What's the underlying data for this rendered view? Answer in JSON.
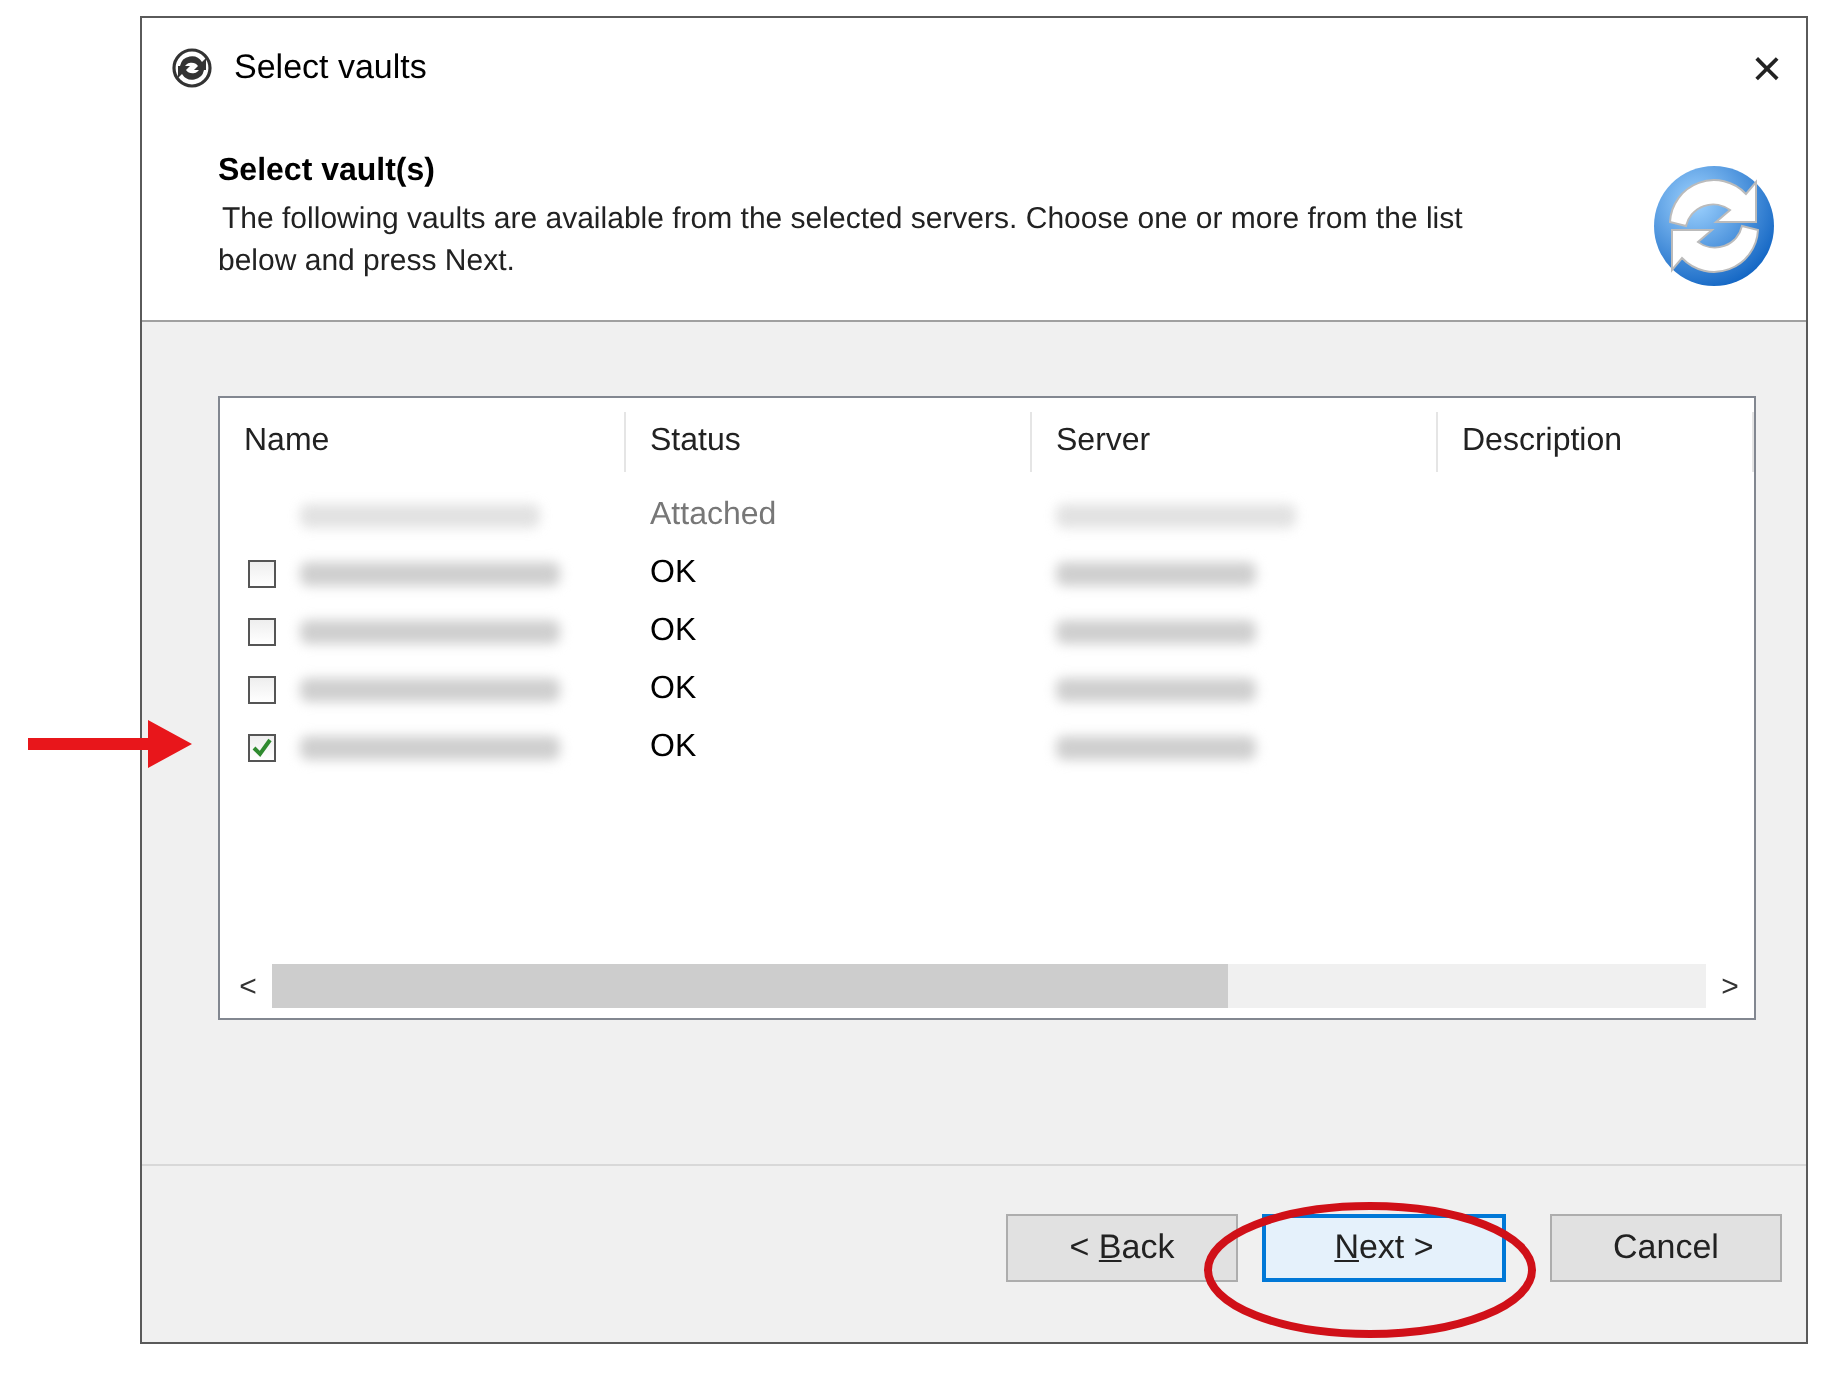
{
  "window": {
    "title": "Select vaults",
    "close": "×"
  },
  "header": {
    "title": "Select vault(s)",
    "description": "The following vaults are available from the selected servers. Choose one or more from the list below and press Next."
  },
  "table": {
    "columns": [
      "Name",
      "Status",
      "Server",
      "Description"
    ],
    "rows": [
      {
        "kind": "plain",
        "status": "Attached",
        "disabled": true
      },
      {
        "kind": "checkbox",
        "checked": false,
        "status": "OK",
        "disabled": false
      },
      {
        "kind": "checkbox",
        "checked": false,
        "status": "OK",
        "disabled": false
      },
      {
        "kind": "checkbox",
        "checked": false,
        "status": "OK",
        "disabled": false
      },
      {
        "kind": "checkbox",
        "checked": true,
        "status": "OK",
        "disabled": false
      }
    ],
    "scroll_left": "<",
    "scroll_right": ">"
  },
  "buttons": [
    {
      "before": "< ",
      "mnemonic": "B",
      "after": "ack",
      "focused": false,
      "highlighted": false
    },
    {
      "mnemonic": "N",
      "after": "ext >",
      "focused": true,
      "highlighted": true
    },
    {
      "label": "Cancel",
      "focused": false,
      "highlighted": false
    }
  ]
}
